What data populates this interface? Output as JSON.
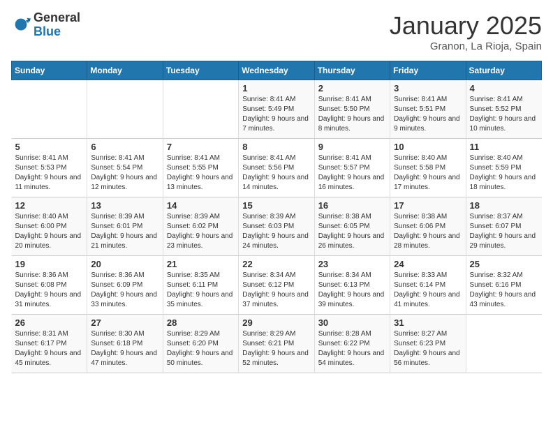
{
  "header": {
    "logo_general": "General",
    "logo_blue": "Blue",
    "month": "January 2025",
    "location": "Granon, La Rioja, Spain"
  },
  "weekdays": [
    "Sunday",
    "Monday",
    "Tuesday",
    "Wednesday",
    "Thursday",
    "Friday",
    "Saturday"
  ],
  "weeks": [
    [
      {
        "day": "",
        "detail": ""
      },
      {
        "day": "",
        "detail": ""
      },
      {
        "day": "",
        "detail": ""
      },
      {
        "day": "1",
        "detail": "Sunrise: 8:41 AM\nSunset: 5:49 PM\nDaylight: 9 hours\nand 7 minutes."
      },
      {
        "day": "2",
        "detail": "Sunrise: 8:41 AM\nSunset: 5:50 PM\nDaylight: 9 hours\nand 8 minutes."
      },
      {
        "day": "3",
        "detail": "Sunrise: 8:41 AM\nSunset: 5:51 PM\nDaylight: 9 hours\nand 9 minutes."
      },
      {
        "day": "4",
        "detail": "Sunrise: 8:41 AM\nSunset: 5:52 PM\nDaylight: 9 hours\nand 10 minutes."
      }
    ],
    [
      {
        "day": "5",
        "detail": "Sunrise: 8:41 AM\nSunset: 5:53 PM\nDaylight: 9 hours\nand 11 minutes."
      },
      {
        "day": "6",
        "detail": "Sunrise: 8:41 AM\nSunset: 5:54 PM\nDaylight: 9 hours\nand 12 minutes."
      },
      {
        "day": "7",
        "detail": "Sunrise: 8:41 AM\nSunset: 5:55 PM\nDaylight: 9 hours\nand 13 minutes."
      },
      {
        "day": "8",
        "detail": "Sunrise: 8:41 AM\nSunset: 5:56 PM\nDaylight: 9 hours\nand 14 minutes."
      },
      {
        "day": "9",
        "detail": "Sunrise: 8:41 AM\nSunset: 5:57 PM\nDaylight: 9 hours\nand 16 minutes."
      },
      {
        "day": "10",
        "detail": "Sunrise: 8:40 AM\nSunset: 5:58 PM\nDaylight: 9 hours\nand 17 minutes."
      },
      {
        "day": "11",
        "detail": "Sunrise: 8:40 AM\nSunset: 5:59 PM\nDaylight: 9 hours\nand 18 minutes."
      }
    ],
    [
      {
        "day": "12",
        "detail": "Sunrise: 8:40 AM\nSunset: 6:00 PM\nDaylight: 9 hours\nand 20 minutes."
      },
      {
        "day": "13",
        "detail": "Sunrise: 8:39 AM\nSunset: 6:01 PM\nDaylight: 9 hours\nand 21 minutes."
      },
      {
        "day": "14",
        "detail": "Sunrise: 8:39 AM\nSunset: 6:02 PM\nDaylight: 9 hours\nand 23 minutes."
      },
      {
        "day": "15",
        "detail": "Sunrise: 8:39 AM\nSunset: 6:03 PM\nDaylight: 9 hours\nand 24 minutes."
      },
      {
        "day": "16",
        "detail": "Sunrise: 8:38 AM\nSunset: 6:05 PM\nDaylight: 9 hours\nand 26 minutes."
      },
      {
        "day": "17",
        "detail": "Sunrise: 8:38 AM\nSunset: 6:06 PM\nDaylight: 9 hours\nand 28 minutes."
      },
      {
        "day": "18",
        "detail": "Sunrise: 8:37 AM\nSunset: 6:07 PM\nDaylight: 9 hours\nand 29 minutes."
      }
    ],
    [
      {
        "day": "19",
        "detail": "Sunrise: 8:36 AM\nSunset: 6:08 PM\nDaylight: 9 hours\nand 31 minutes."
      },
      {
        "day": "20",
        "detail": "Sunrise: 8:36 AM\nSunset: 6:09 PM\nDaylight: 9 hours\nand 33 minutes."
      },
      {
        "day": "21",
        "detail": "Sunrise: 8:35 AM\nSunset: 6:11 PM\nDaylight: 9 hours\nand 35 minutes."
      },
      {
        "day": "22",
        "detail": "Sunrise: 8:34 AM\nSunset: 6:12 PM\nDaylight: 9 hours\nand 37 minutes."
      },
      {
        "day": "23",
        "detail": "Sunrise: 8:34 AM\nSunset: 6:13 PM\nDaylight: 9 hours\nand 39 minutes."
      },
      {
        "day": "24",
        "detail": "Sunrise: 8:33 AM\nSunset: 6:14 PM\nDaylight: 9 hours\nand 41 minutes."
      },
      {
        "day": "25",
        "detail": "Sunrise: 8:32 AM\nSunset: 6:16 PM\nDaylight: 9 hours\nand 43 minutes."
      }
    ],
    [
      {
        "day": "26",
        "detail": "Sunrise: 8:31 AM\nSunset: 6:17 PM\nDaylight: 9 hours\nand 45 minutes."
      },
      {
        "day": "27",
        "detail": "Sunrise: 8:30 AM\nSunset: 6:18 PM\nDaylight: 9 hours\nand 47 minutes."
      },
      {
        "day": "28",
        "detail": "Sunrise: 8:29 AM\nSunset: 6:20 PM\nDaylight: 9 hours\nand 50 minutes."
      },
      {
        "day": "29",
        "detail": "Sunrise: 8:29 AM\nSunset: 6:21 PM\nDaylight: 9 hours\nand 52 minutes."
      },
      {
        "day": "30",
        "detail": "Sunrise: 8:28 AM\nSunset: 6:22 PM\nDaylight: 9 hours\nand 54 minutes."
      },
      {
        "day": "31",
        "detail": "Sunrise: 8:27 AM\nSunset: 6:23 PM\nDaylight: 9 hours\nand 56 minutes."
      },
      {
        "day": "",
        "detail": ""
      }
    ]
  ]
}
